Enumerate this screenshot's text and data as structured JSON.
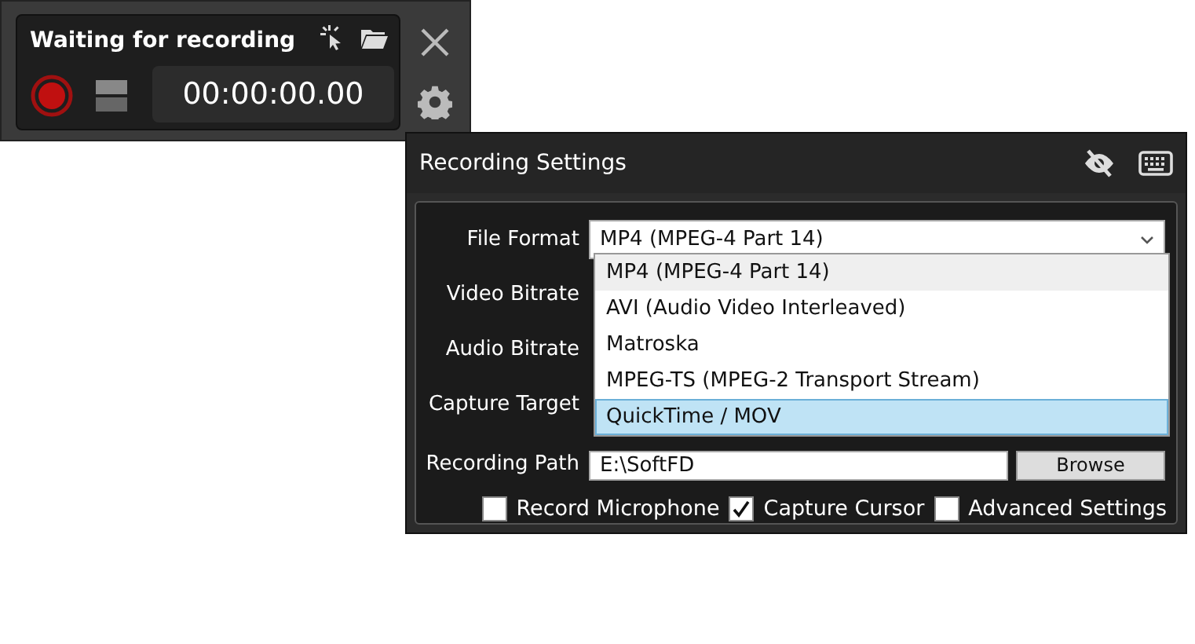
{
  "recorder": {
    "status": "Waiting for recording",
    "timer": "00:00:00.00",
    "recording": false
  },
  "settings": {
    "title": "Recording Settings",
    "fields": [
      {
        "label": "File Format",
        "kind": "select",
        "value": "MP4 (MPEG-4 Part 14)"
      },
      {
        "label": "Video Bitrate",
        "kind": "hidden"
      },
      {
        "label": "Audio Bitrate",
        "kind": "hidden"
      },
      {
        "label": "Capture Target",
        "kind": "hidden"
      },
      {
        "label": "Recording Path",
        "kind": "path",
        "value": "E:\\SoftFD",
        "button": "Browse"
      }
    ],
    "dropdown": [
      {
        "label": "MP4 (MPEG-4 Part 14)",
        "current": true,
        "selected": false
      },
      {
        "label": "AVI (Audio Video Interleaved)",
        "current": false,
        "selected": false
      },
      {
        "label": "Matroska",
        "current": false,
        "selected": false
      },
      {
        "label": "MPEG-TS (MPEG-2 Transport Stream)",
        "current": false,
        "selected": false
      },
      {
        "label": "QuickTime / MOV",
        "current": false,
        "selected": true
      }
    ],
    "checkboxes": [
      {
        "label": "Record Microphone",
        "checked": false
      },
      {
        "label": "Capture Cursor",
        "checked": true
      },
      {
        "label": "Advanced Settings",
        "checked": false
      }
    ]
  }
}
